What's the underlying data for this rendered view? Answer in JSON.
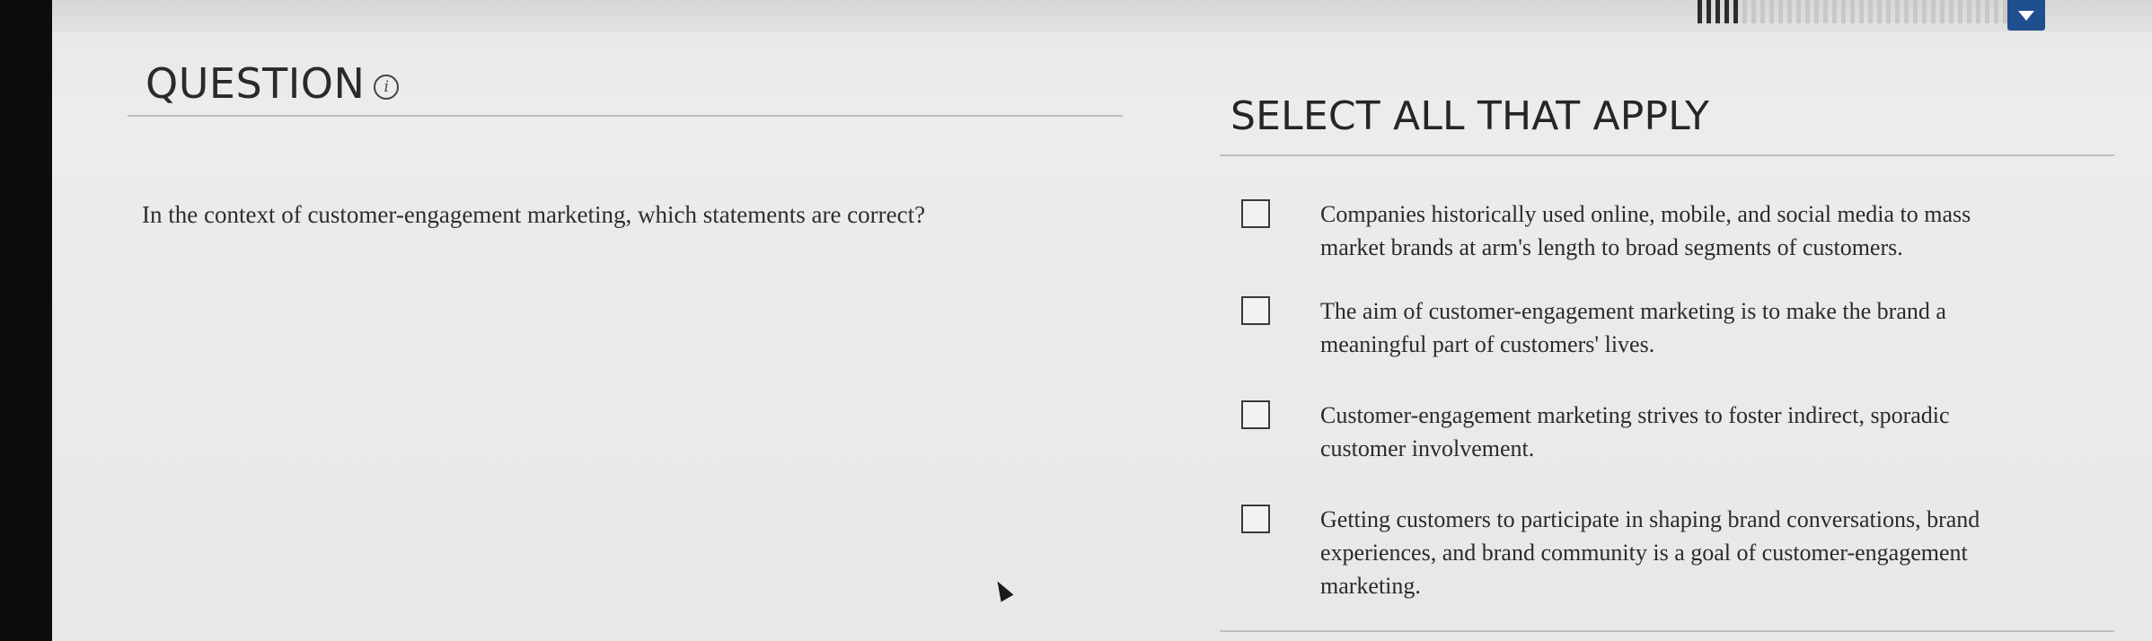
{
  "header": {
    "progress": {
      "completed": 5,
      "total": 35
    },
    "dropdown_icon": "chevron-down-icon"
  },
  "question": {
    "heading": "QUESTION",
    "info_icon": "i",
    "text": "In the context of customer-engagement marketing, which statements are correct?"
  },
  "answers": {
    "heading": "SELECT ALL THAT APPLY",
    "options": [
      {
        "label": "Companies historically used online, mobile, and social media to mass market brands at arm's length to broad segments of customers.",
        "checked": false
      },
      {
        "label": "The aim of customer-engagement marketing is to make the brand a meaningful part of customers' lives.",
        "checked": false
      },
      {
        "label": "Customer-engagement marketing strives to foster indirect, sporadic customer involvement.",
        "checked": false
      },
      {
        "label": "Getting customers to participate in shaping brand conversations, brand experiences, and brand community is a goal of customer-engagement marketing.",
        "checked": false
      }
    ]
  },
  "colors": {
    "accent": "#1f4f8f",
    "background": "#ececea",
    "text": "#2b2b2b"
  }
}
